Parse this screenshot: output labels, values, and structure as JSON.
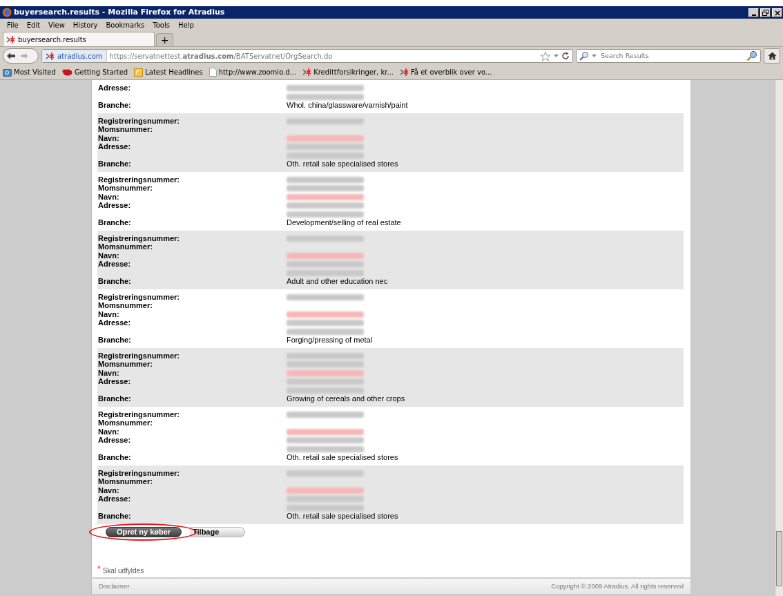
{
  "window": {
    "title": "buyersearch.results - Mozilla Firefox for Atradius"
  },
  "menu": [
    "File",
    "Edit",
    "View",
    "History",
    "Bookmarks",
    "Tools",
    "Help"
  ],
  "tabs": [
    {
      "label": "buyersearch.results",
      "selected": true
    }
  ],
  "new_tab": "+",
  "address_bar": {
    "site": "atradius.com",
    "url": "https://servatnettest.**atradius.com**/BATServatnet/OrgSearch.do"
  },
  "search": {
    "placeholder": "Search Results"
  },
  "bookmarks": [
    {
      "label": "Most Visited",
      "kind": "folder"
    },
    {
      "label": "Getting Started",
      "kind": "animal"
    },
    {
      "label": "Latest Headlines",
      "kind": "feed"
    },
    {
      "label": "http://www.zoomio.d...",
      "kind": "page"
    },
    {
      "label": "Kredittforsikringer, kr...",
      "kind": "site"
    },
    {
      "label": "Få et overblik over vo...",
      "kind": "site"
    }
  ],
  "records": [
    {
      "shaded": false,
      "rows": [
        {
          "label": "Adresse:",
          "redacted": true,
          "color": "#c9c9c9"
        },
        {
          "redacted": true,
          "color": "#c9c9c9"
        },
        {
          "label": "Branche:",
          "value": "Whol. china/glassware/varnish/paint"
        }
      ]
    },
    {
      "shaded": true,
      "rows": [
        {
          "label": "Registreringsnummer:",
          "redacted": true,
          "color": "#c9c9c9"
        },
        {
          "label": "Momsnummer:",
          "redacted": false
        },
        {
          "label": "Navn:",
          "redacted": true,
          "color": "#f6b7b7"
        },
        {
          "label": "Adresse:",
          "redacted": true,
          "color": "#c9c9c9"
        },
        {
          "redacted": true,
          "color": "#c9c9c9"
        },
        {
          "label": "Branche:",
          "value": "Oth. retail sale specialised stores"
        }
      ]
    },
    {
      "shaded": false,
      "rows": [
        {
          "label": "Registreringsnummer:",
          "redacted": true,
          "color": "#c9c9c9"
        },
        {
          "label": "Momsnummer:",
          "redacted": true,
          "color": "#c9c9c9"
        },
        {
          "label": "Navn:",
          "redacted": true,
          "color": "#f6b7b7"
        },
        {
          "label": "Adresse:",
          "redacted": true,
          "color": "#c9c9c9"
        },
        {
          "redacted": true,
          "color": "#c9c9c9"
        },
        {
          "label": "Branche:",
          "value": "Development/selling of real estate"
        }
      ]
    },
    {
      "shaded": true,
      "rows": [
        {
          "label": "Registreringsnummer:",
          "redacted": true,
          "color": "#c9c9c9"
        },
        {
          "label": "Momsnummer:",
          "redacted": false
        },
        {
          "label": "Navn:",
          "redacted": true,
          "color": "#f6b7b7"
        },
        {
          "label": "Adresse:",
          "redacted": true,
          "color": "#c9c9c9"
        },
        {
          "redacted": true,
          "color": "#c9c9c9"
        },
        {
          "label": "Branche:",
          "value": "Adult and other education nec"
        }
      ]
    },
    {
      "shaded": false,
      "rows": [
        {
          "label": "Registreringsnummer:",
          "redacted": true,
          "color": "#c9c9c9"
        },
        {
          "label": "Momsnummer:",
          "redacted": false
        },
        {
          "label": "Navn:",
          "redacted": true,
          "color": "#f6b7b7"
        },
        {
          "label": "Adresse:",
          "redacted": true,
          "color": "#c9c9c9"
        },
        {
          "redacted": true,
          "color": "#c9c9c9"
        },
        {
          "label": "Branche:",
          "value": "Forging/pressing of metal"
        }
      ]
    },
    {
      "shaded": true,
      "rows": [
        {
          "label": "Registreringsnummer:",
          "redacted": true,
          "color": "#c9c9c9"
        },
        {
          "label": "Momsnummer:",
          "redacted": true,
          "color": "#c9c9c9"
        },
        {
          "label": "Navn:",
          "redacted": true,
          "color": "#f6b7b7"
        },
        {
          "label": "Adresse:",
          "redacted": true,
          "color": "#c9c9c9"
        },
        {
          "redacted": true,
          "color": "#c9c9c9"
        },
        {
          "label": "Branche:",
          "value": "Growing of cereals and other crops"
        }
      ]
    },
    {
      "shaded": false,
      "rows": [
        {
          "label": "Registreringsnummer:",
          "redacted": true,
          "color": "#c9c9c9"
        },
        {
          "label": "Momsnummer:",
          "redacted": false
        },
        {
          "label": "Navn:",
          "redacted": true,
          "color": "#f6b7b7"
        },
        {
          "label": "Adresse:",
          "redacted": true,
          "color": "#c9c9c9"
        },
        {
          "redacted": true,
          "color": "#c9c9c9"
        },
        {
          "label": "Branche:",
          "value": "Oth. retail sale specialised stores"
        }
      ]
    },
    {
      "shaded": true,
      "rows": [
        {
          "label": "Registreringsnummer:",
          "redacted": true,
          "color": "#c9c9c9"
        },
        {
          "label": "Momsnummer:",
          "redacted": false
        },
        {
          "label": "Navn:",
          "redacted": true,
          "color": "#f6b7b7"
        },
        {
          "label": "Adresse:",
          "redacted": true,
          "color": "#c9c9c9"
        },
        {
          "redacted": true,
          "color": "#c9c9c9"
        },
        {
          "label": "Branche:",
          "value": "Oth. retail sale specialised stores"
        }
      ]
    }
  ],
  "buttons": [
    {
      "label": "Opret ny køber",
      "kind": "primary",
      "highlighted": true
    },
    {
      "label": "Tilbage",
      "kind": "secondary",
      "highlighted": false
    }
  ],
  "required_note": {
    "mark": "*",
    "text": "Skal udfyldes"
  },
  "footer": {
    "left": "Disclaimer",
    "right": "Copyright © 2009 Atradius. All rights reserved"
  }
}
